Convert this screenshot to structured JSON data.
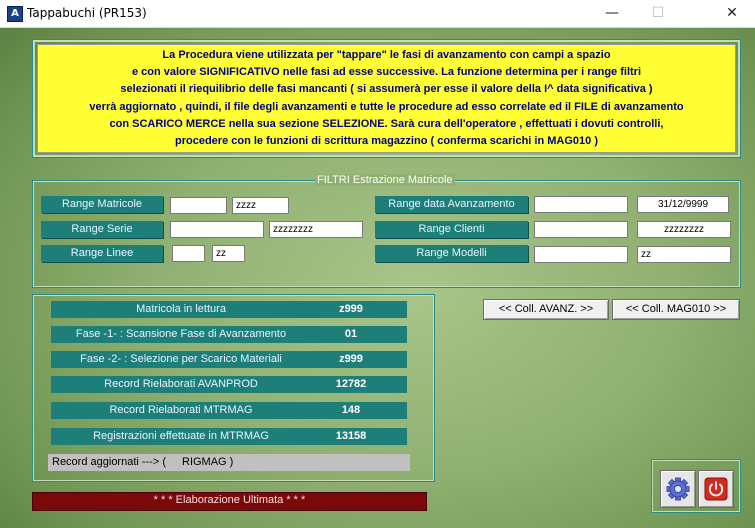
{
  "window": {
    "title": "Tappabuchi (PR153)",
    "app_icon_glyph": "A",
    "minimize_glyph": "—",
    "maximize_glyph": "☐",
    "close_glyph": "✕"
  },
  "info": {
    "lines": [
      "La Procedura viene utilizzata per \"tappare\" le fasi di avanzamento con campi a spazio",
      "e con valore SIGNIFICATIVO nelle fasi ad esse successive. La funzione determina per i range filtri",
      "selezionati il riequilibrio delle fasi mancanti ( si assumerà per esse il valore della I^ data significativa )",
      "verrà aggiornato , quindi, il file degli avanzamenti e tutte le procedure ad esso correlate ed il FILE di avanzamento",
      "con SCARICO MERCE nella sua sezione SELEZIONE. Sarà cura dell'operatore , effettuati i dovuti controlli,",
      "procedere con le funzioni di scrittura magazzino ( conferma scarichi in MAG010 )"
    ]
  },
  "filters": {
    "legend": "FILTRI  Estrazione Matricole",
    "range_matricole": {
      "label": "Range Matricole",
      "from": "",
      "to": "zzzz"
    },
    "range_serie": {
      "label": "Range Serie",
      "from": "",
      "to": "zzzzzzzz"
    },
    "range_linee": {
      "label": "Range Linee",
      "from": "",
      "to": "zz"
    },
    "range_data": {
      "label": "Range data Avanzamento",
      "from": "",
      "to": "31/12/9999"
    },
    "range_clienti": {
      "label": "Range Clienti",
      "from": "",
      "to": "zzzzzzzz"
    },
    "range_modelli": {
      "label": "Range Modelli",
      "from": "",
      "to": "zz"
    }
  },
  "status": {
    "rows": [
      {
        "label": "Matricola in lettura",
        "value": "z999"
      },
      {
        "label": "Fase -1- : Scansione Fase di Avanzamento",
        "value": "01"
      },
      {
        "label": "Fase -2- : Selezione per Scarico Materiali",
        "value": "z999"
      },
      {
        "label": "Record Rielaborati AVANPROD",
        "value": "12782"
      },
      {
        "label": "Record Rielaborati MTRMAG",
        "value": "148"
      },
      {
        "label": "Registrazioni effettuate in MTRMAG",
        "value": "13158"
      }
    ],
    "updated_label": "Record aggiornati ---> (",
    "updated_value": "RIGMAG  )",
    "done_text": "* * *   Elaborazione Ultimata   * * *"
  },
  "buttons": {
    "coll_avanz": "<<  Coll. AVANZ.  >>",
    "coll_mag010": "<< Coll. MAG010 >>"
  },
  "icons": {
    "settings": "gear-icon",
    "exit": "power-icon"
  },
  "colors": {
    "teal_label": "#1e7f7a",
    "info_bg": "#ffff33",
    "info_text": "#000080",
    "done_bar": "#7a0a0a"
  }
}
